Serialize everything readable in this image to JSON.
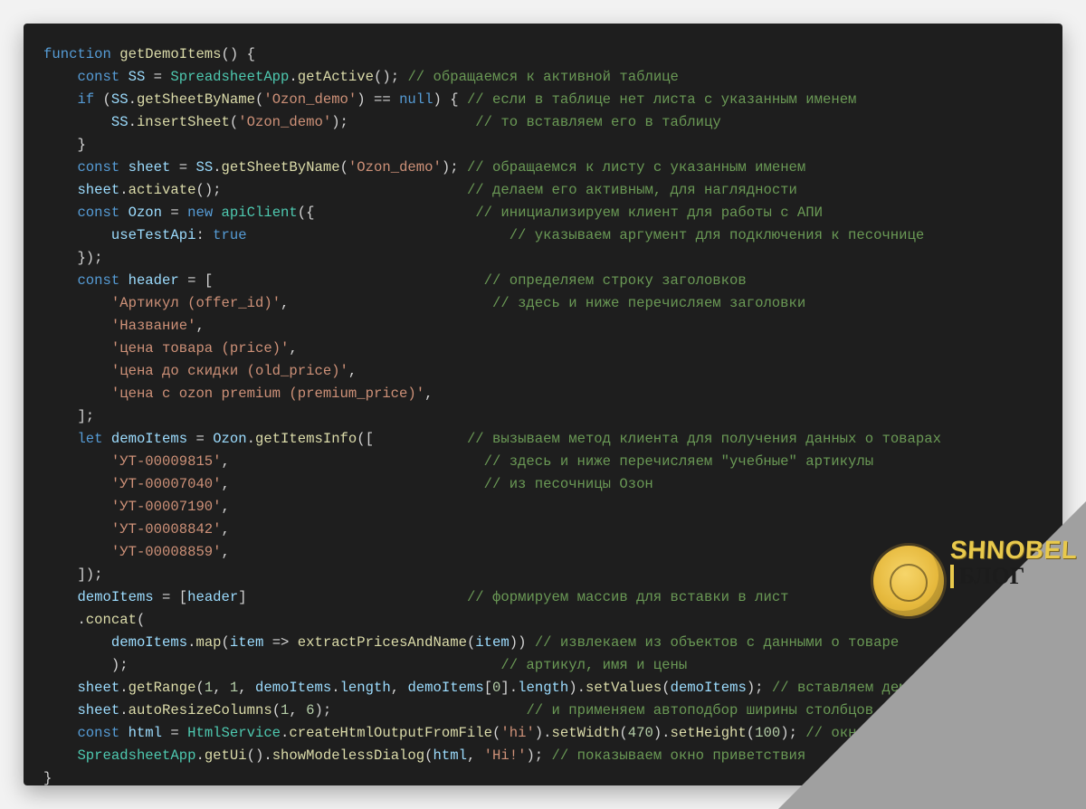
{
  "watermark": {
    "brand": "SHNOBEL",
    "sub": "БЛОГ"
  },
  "code": {
    "functionName": "getDemoItems",
    "sheetName": "Ozon_demo",
    "className": "apiClient",
    "useTestApiKey": "useTestApi",
    "useTestApiValue": "true",
    "headerArrayName": "header",
    "headerValues": [
      "Артикул (offer_id)",
      "Название",
      "цена товара (price)",
      "цена до скидки (old_price)",
      "цена с ozon premium (premium_price)"
    ],
    "demoItemsName": "demoItems",
    "articles": [
      "УТ-00009815",
      "УТ-00007040",
      "УТ-00007190",
      "УТ-00008842",
      "УТ-00008859"
    ],
    "extractFn": "extractPricesAndName",
    "htmlFile": "hi",
    "setWidth": "470",
    "setHeight": "100",
    "dialogTitle": "Hi!",
    "autoResizeCols": {
      "start": "1",
      "count": "6"
    },
    "comments": {
      "getActive": "// обращаемся к активной таблице",
      "ifNoSheet": "// если в таблице нет листа с указанным именем",
      "insertSheet": "// то вставляем его в таблицу",
      "getSheet": "// обращаемся к листу с указанным именем",
      "activate": "// делаем его активным, для наглядности",
      "newClient": "// инициализируем клиент для работы с АПИ",
      "useTestApi": "// указываем аргумент для подключения к песочнице",
      "headerDef": "// определяем строку заголовков",
      "headerList": "// здесь и ниже перечисляем заголовки",
      "getItemsInfo": "// вызываем метод клиента для получения данных о товарах",
      "articlesList": "// здесь и ниже перечисляем \"учебные\" артикулы",
      "sandbox": "// из песочницы Озон",
      "formArray": "// формируем массив для вставки в лист",
      "extract": "// извлекаем из объектов с данными о товаре",
      "extract2": "// артикул, имя и цены",
      "setValues": "// вставляем демо-данные",
      "autoResize": "// и применяем автоподбор ширины столбцов к диапазону",
      "htmlService": "// окно приветствия",
      "showDialog": "// показываем окно приветствия"
    }
  }
}
